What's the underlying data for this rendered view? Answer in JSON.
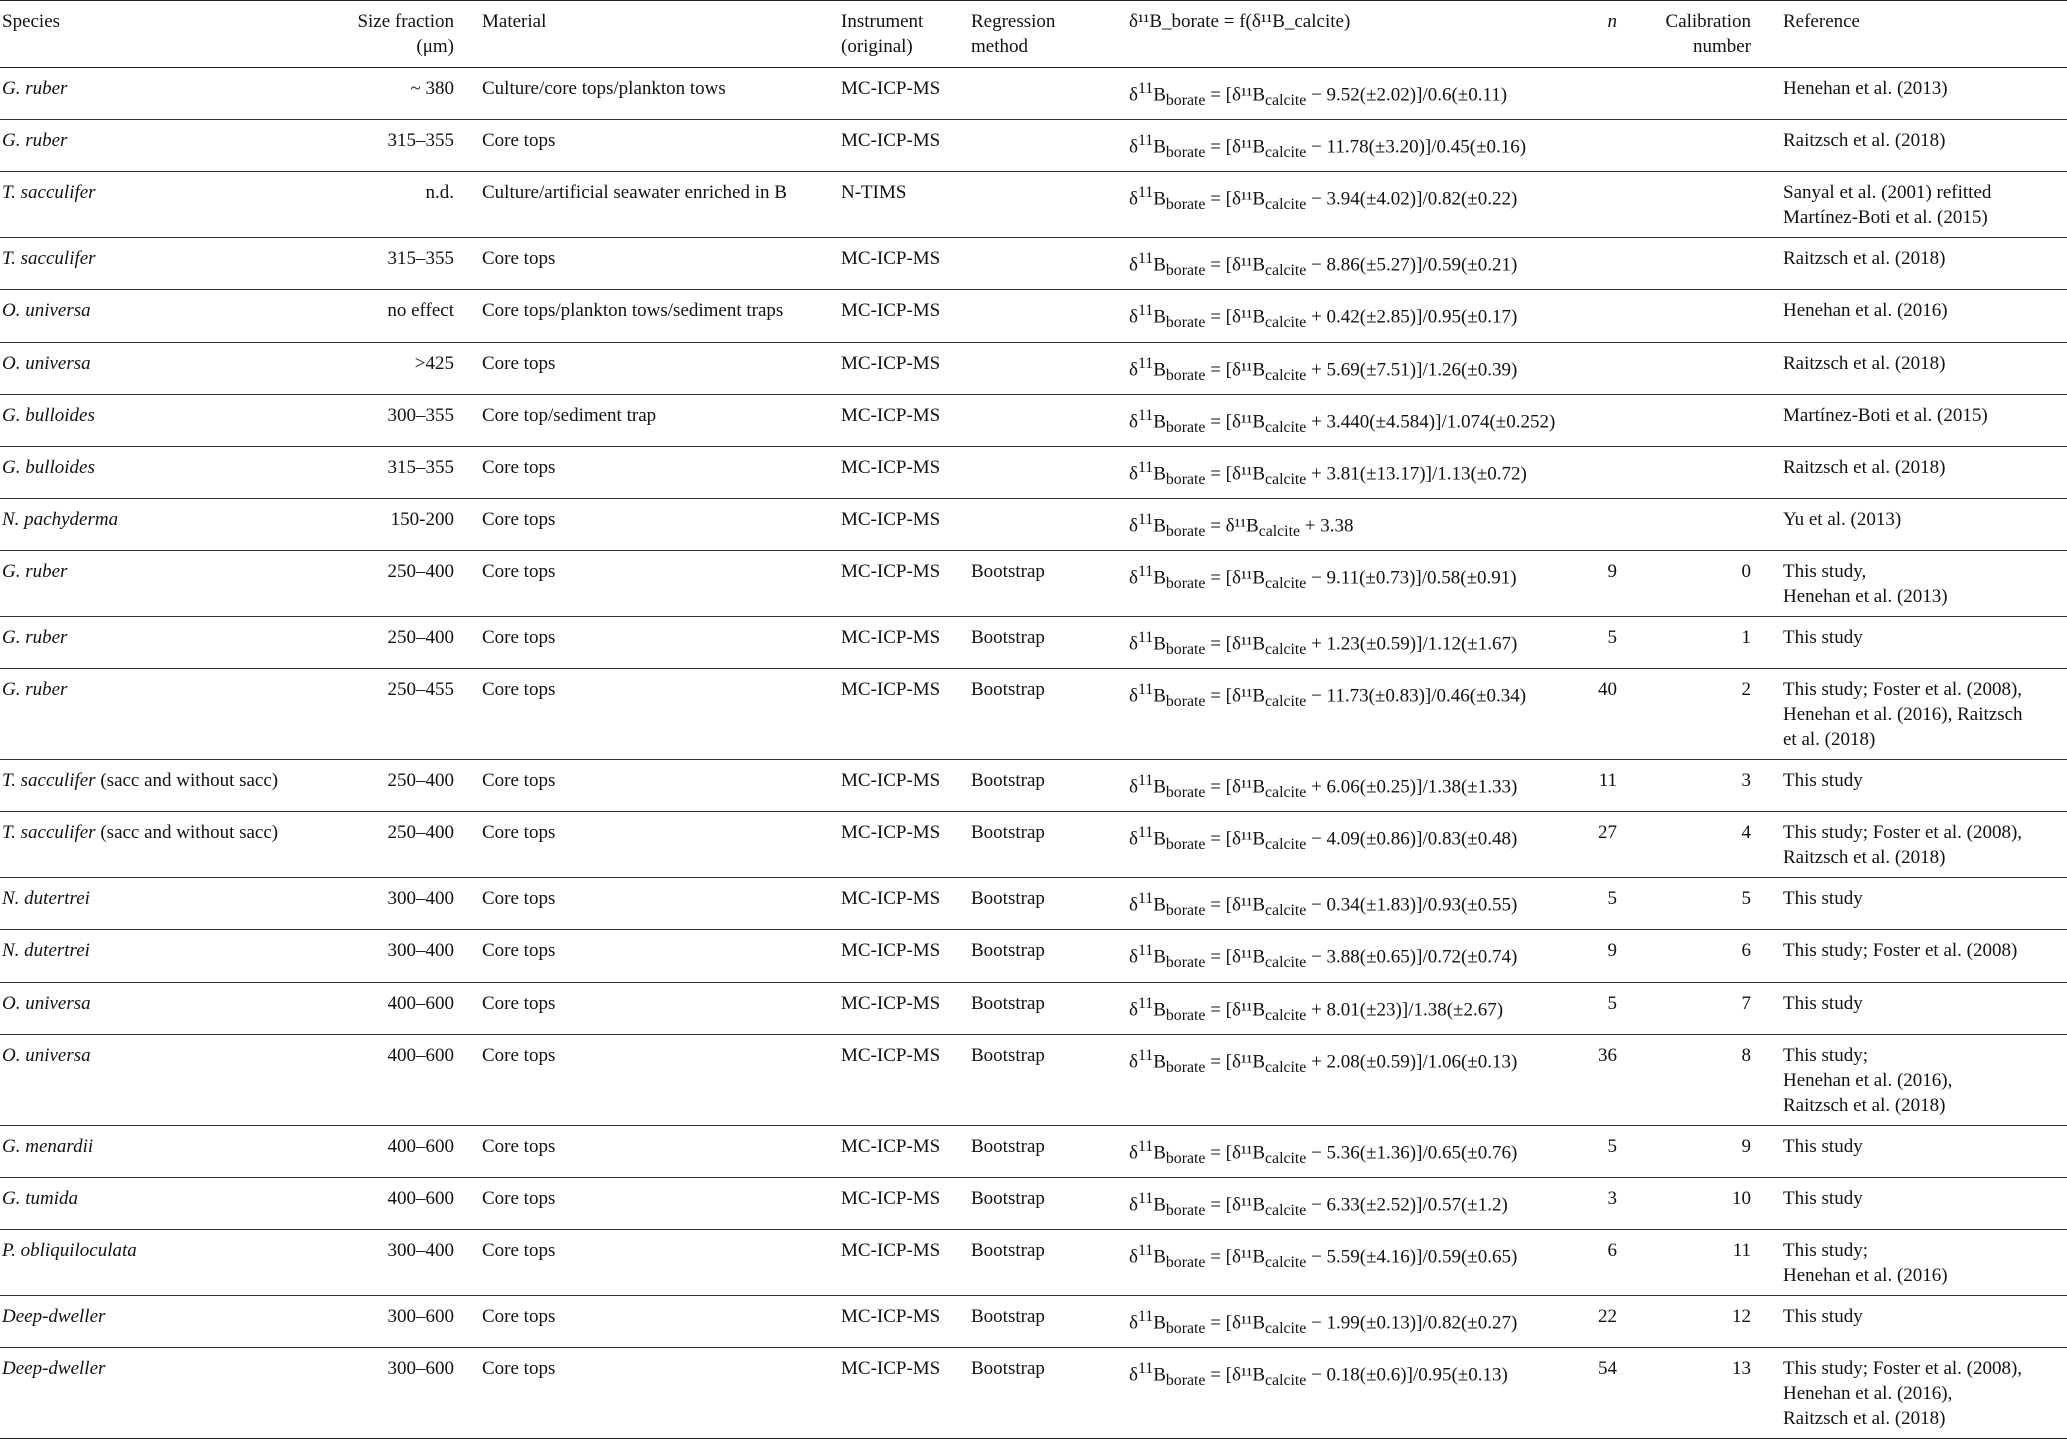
{
  "table": {
    "headers": {
      "species": "Species",
      "size_fraction": "Size fraction (μm)",
      "material": "Material",
      "instrument": "Instrument (original)",
      "regression_method": "Regression method",
      "equation": "δ¹¹B_borate = f(δ¹¹B_calcite)",
      "n": "n",
      "calibration_number": "Calibration number",
      "reference": "Reference"
    },
    "rows": [
      {
        "species": "G. ruber",
        "species_extra": "",
        "size": "~ 380",
        "material": "Culture/core tops/plankton tows",
        "instrument": "MC-ICP-MS",
        "regression": "",
        "eq_pre": "[δ¹¹B",
        "eq_post": "− 9.52(±2.02)]/0.6(±0.11)",
        "n": "",
        "cal": "",
        "reference": [
          "Henehan et al. (2013)"
        ]
      },
      {
        "species": "G. ruber",
        "species_extra": "",
        "size": "315–355",
        "material": "Core tops",
        "instrument": "MC-ICP-MS",
        "regression": "",
        "eq_pre": "[δ¹¹B",
        "eq_post": "− 11.78(±3.20)]/0.45(±0.16)",
        "n": "",
        "cal": "",
        "reference": [
          "Raitzsch et al. (2018)"
        ]
      },
      {
        "species": "T. sacculifer",
        "species_extra": "",
        "size": "n.d.",
        "material": "Culture/artificial seawater enriched in B",
        "instrument": "N-TIMS",
        "regression": "",
        "eq_pre": "[δ¹¹B",
        "eq_post": "− 3.94(±4.02)]/0.82(±0.22)",
        "n": "",
        "cal": "",
        "reference": [
          "Sanyal et al. (2001) refitted",
          "Martínez-Boti et al. (2015)"
        ]
      },
      {
        "species": "T. sacculifer",
        "species_extra": "",
        "size": "315–355",
        "material": "Core tops",
        "instrument": "MC-ICP-MS",
        "regression": "",
        "eq_pre": "[δ¹¹B",
        "eq_post": "− 8.86(±5.27)]/0.59(±0.21)",
        "n": "",
        "cal": "",
        "reference": [
          "Raitzsch et al. (2018)"
        ]
      },
      {
        "species": "O. universa",
        "species_extra": "",
        "size": "no effect",
        "material": "Core tops/plankton tows/sediment traps",
        "instrument": "MC-ICP-MS",
        "regression": "",
        "eq_pre": "[δ¹¹B",
        "eq_post": "+ 0.42(±2.85)]/0.95(±0.17)",
        "n": "",
        "cal": "",
        "reference": [
          "Henehan et al. (2016)"
        ]
      },
      {
        "species": "O. universa",
        "species_extra": "",
        "size": ">425",
        "material": "Core tops",
        "instrument": "MC-ICP-MS",
        "regression": "",
        "eq_pre": "[δ¹¹B",
        "eq_post": "+ 5.69(±7.51)]/1.26(±0.39)",
        "n": "",
        "cal": "",
        "reference": [
          "Raitzsch et al. (2018)"
        ]
      },
      {
        "species": "G. bulloides",
        "species_extra": "",
        "size": "300–355",
        "material": "Core top/sediment trap",
        "instrument": "MC-ICP-MS",
        "regression": "",
        "eq_pre": "[δ¹¹B",
        "eq_post": "+ 3.440(±4.584)]/1.074(±0.252)",
        "n": "",
        "cal": "",
        "reference": [
          "Martínez-Boti et al. (2015)"
        ]
      },
      {
        "species": "G. bulloides",
        "species_extra": "",
        "size": "315–355",
        "material": "Core tops",
        "instrument": "MC-ICP-MS",
        "regression": "",
        "eq_pre": "[δ¹¹B",
        "eq_post": "+ 3.81(±13.17)]/1.13(±0.72)",
        "n": "",
        "cal": "",
        "reference": [
          "Raitzsch et al. (2018)"
        ]
      },
      {
        "species": "N. pachyderma",
        "species_extra": "",
        "size": "150-200",
        "material": "Core tops",
        "instrument": "MC-ICP-MS",
        "regression": "",
        "eq_pre": "δ¹¹B",
        "eq_post": "+ 3.38",
        "n": "",
        "cal": "",
        "reference": [
          "Yu et al. (2013)"
        ]
      },
      {
        "species": "G. ruber",
        "species_extra": "",
        "size": "250–400",
        "material": "Core tops",
        "instrument": "MC-ICP-MS",
        "regression": "Bootstrap",
        "eq_pre": "[δ¹¹B",
        "eq_post": "− 9.11(±0.73)]/0.58(±0.91)",
        "n": "9",
        "cal": "0",
        "reference": [
          "This study,",
          "Henehan et al. (2013)"
        ]
      },
      {
        "species": "G. ruber",
        "species_extra": "",
        "size": "250–400",
        "material": "Core tops",
        "instrument": "MC-ICP-MS",
        "regression": "Bootstrap",
        "eq_pre": "[δ¹¹B",
        "eq_post": "+ 1.23(±0.59)]/1.12(±1.67)",
        "n": "5",
        "cal": "1",
        "reference": [
          "This study"
        ]
      },
      {
        "species": "G. ruber",
        "species_extra": "",
        "size": "250–455",
        "material": "Core tops",
        "instrument": "MC-ICP-MS",
        "regression": "Bootstrap",
        "eq_pre": "[δ¹¹B",
        "eq_post": "− 11.73(±0.83)]/0.46(±0.34)",
        "n": "40",
        "cal": "2",
        "reference": [
          "This study; Foster et al. (2008),",
          "Henehan et al. (2016), Raitzsch",
          "et al. (2018)"
        ]
      },
      {
        "species": "T. sacculifer",
        "species_extra": " (sacc and without sacc)",
        "size": "250–400",
        "material": "Core tops",
        "instrument": "MC-ICP-MS",
        "regression": "Bootstrap",
        "eq_pre": "[δ¹¹B",
        "eq_post": "+ 6.06(±0.25)]/1.38(±1.33)",
        "n": "11",
        "cal": "3",
        "reference": [
          "This study"
        ]
      },
      {
        "species": "T. sacculifer",
        "species_extra": " (sacc and without sacc)",
        "size": "250–400",
        "material": "Core tops",
        "instrument": "MC-ICP-MS",
        "regression": "Bootstrap",
        "eq_pre": "[δ¹¹B",
        "eq_post": "− 4.09(±0.86)]/0.83(±0.48)",
        "n": "27",
        "cal": "4",
        "reference": [
          "This study; Foster et al. (2008),",
          "Raitzsch et al. (2018)"
        ]
      },
      {
        "species": "N. dutertrei",
        "species_extra": "",
        "size": "300–400",
        "material": "Core tops",
        "instrument": "MC-ICP-MS",
        "regression": "Bootstrap",
        "eq_pre": "[δ¹¹B",
        "eq_post": "− 0.34(±1.83)]/0.93(±0.55)",
        "n": "5",
        "cal": "5",
        "reference": [
          "This study"
        ]
      },
      {
        "species": "N. dutertrei",
        "species_extra": "",
        "size": "300–400",
        "material": "Core tops",
        "instrument": "MC-ICP-MS",
        "regression": "Bootstrap",
        "eq_pre": "[δ¹¹B",
        "eq_post": "− 3.88(±0.65)]/0.72(±0.74)",
        "n": "9",
        "cal": "6",
        "reference": [
          "This study; Foster et al. (2008)"
        ]
      },
      {
        "species": "O. universa",
        "species_extra": "",
        "size": "400–600",
        "material": "Core tops",
        "instrument": "MC-ICP-MS",
        "regression": "Bootstrap",
        "eq_pre": "[δ¹¹B",
        "eq_post": "+ 8.01(±23)]/1.38(±2.67)",
        "n": "5",
        "cal": "7",
        "reference": [
          "This study"
        ]
      },
      {
        "species": "O. universa",
        "species_extra": "",
        "size": "400–600",
        "material": "Core tops",
        "instrument": "MC-ICP-MS",
        "regression": "Bootstrap",
        "eq_pre": "[δ¹¹B",
        "eq_post": "+ 2.08(±0.59)]/1.06(±0.13)",
        "n": "36",
        "cal": "8",
        "reference": [
          "This study;",
          "Henehan et al. (2016),",
          "Raitzsch et al. (2018)"
        ]
      },
      {
        "species": "G. menardii",
        "species_extra": "",
        "size": "400–600",
        "material": "Core tops",
        "instrument": "MC-ICP-MS",
        "regression": "Bootstrap",
        "eq_pre": "[δ¹¹B",
        "eq_post": "− 5.36(±1.36)]/0.65(±0.76)",
        "n": "5",
        "cal": "9",
        "reference": [
          "This study"
        ]
      },
      {
        "species": "G. tumida",
        "species_extra": "",
        "size": "400–600",
        "material": "Core tops",
        "instrument": "MC-ICP-MS",
        "regression": "Bootstrap",
        "eq_pre": "[δ¹¹B",
        "eq_post": "− 6.33(±2.52)]/0.57(±1.2)",
        "n": "3",
        "cal": "10",
        "reference": [
          "This study"
        ]
      },
      {
        "species": "P. obliquiloculata",
        "species_extra": "",
        "size": "300–400",
        "material": "Core tops",
        "instrument": "MC-ICP-MS",
        "regression": "Bootstrap",
        "eq_pre": "[δ¹¹B",
        "eq_post": "− 5.59(±4.16)]/0.59(±0.65)",
        "n": "6",
        "cal": "11",
        "reference": [
          "This study;",
          "Henehan et al. (2016)"
        ]
      },
      {
        "species": "Deep-dweller",
        "species_extra": "",
        "size": "300–600",
        "material": "Core tops",
        "instrument": "MC-ICP-MS",
        "regression": "Bootstrap",
        "eq_pre": "[δ¹¹B",
        "eq_post": "− 1.99(±0.13)]/0.82(±0.27)",
        "n": "22",
        "cal": "12",
        "reference": [
          "This study"
        ]
      },
      {
        "species": "Deep-dweller",
        "species_extra": "",
        "size": "300–600",
        "material": "Core tops",
        "instrument": "MC-ICP-MS",
        "regression": "Bootstrap",
        "eq_pre": "[δ¹¹B",
        "eq_post": "− 0.18(±0.6)]/0.95(±0.13)",
        "n": "54",
        "cal": "13",
        "reference": [
          "This study; Foster et al. (2008),",
          "Henehan et al. (2016),",
          "Raitzsch et al. (2018)"
        ]
      }
    ]
  }
}
